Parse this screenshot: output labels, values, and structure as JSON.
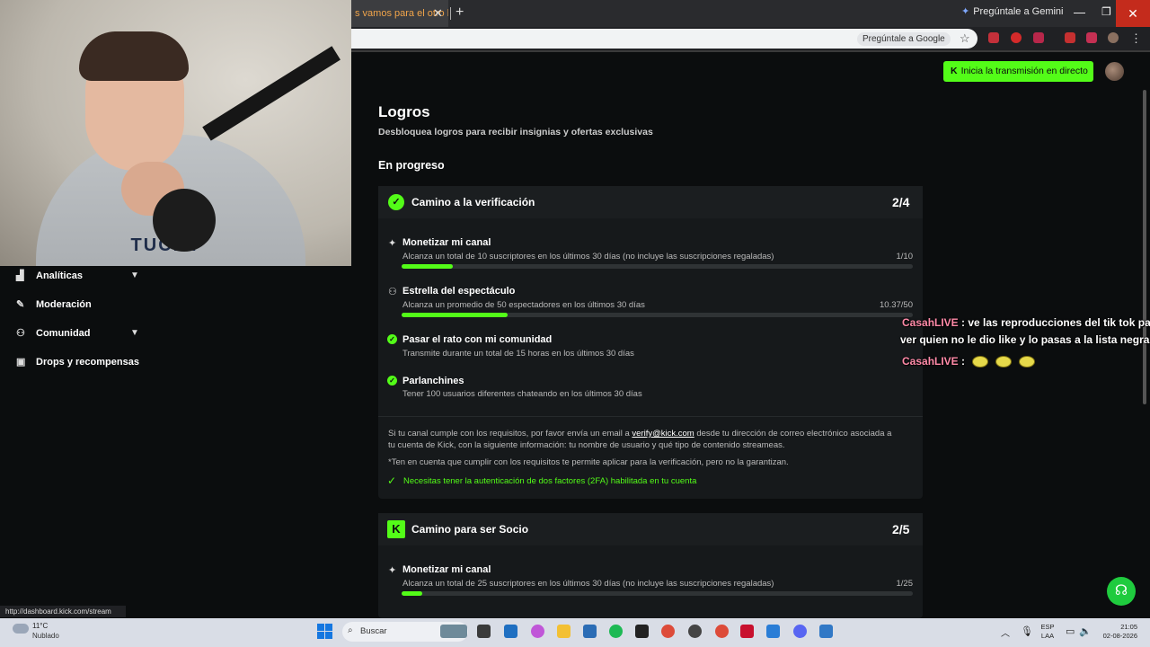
{
  "browser": {
    "tab_title": "s vamos para el otro lad",
    "tab_close": "✕",
    "new_tab": "+",
    "gemini": "Pregúntale a Gemini",
    "ask_google": "Pregúntale a Google",
    "status_url": "http://dashboard.kick.com/stream"
  },
  "header": {
    "stream_button": "Inicia la transmisión en directo"
  },
  "page": {
    "title": "Logros",
    "subtitle": "Desbloquea logros para recibir insignias y ofertas exclusivas",
    "section": "En progreso"
  },
  "card_verification": {
    "title": "Camino a la verificación",
    "count": "2/4",
    "items": [
      {
        "title": "Monetizar mi canal",
        "desc": "Alcanza un total de 10 suscriptores en los últimos 30 días (no incluye las suscripciones regaladas)",
        "progress": "1/10",
        "fill": 0.1
      },
      {
        "title": "Estrella del espectáculo",
        "desc": "Alcanza un promedio de 50 espectadores en los últimos 30 días",
        "progress": "10.37/50",
        "fill": 0.2074
      },
      {
        "title": "Pasar el rato con mi comunidad",
        "desc": "Transmite durante un total de 15 horas en los últimos 30 días"
      },
      {
        "title": "Parlanchines",
        "desc": "Tener 100 usuarios diferentes chateando en los últimos 30 días"
      }
    ],
    "info_prefix": "Si tu canal cumple con los requisitos, por favor envía un email a ",
    "info_email": "verify@kick.com",
    "info_suffix_line1": " desde tu dirección de correo electrónico asociada a",
    "info_line2": "tu cuenta de Kick, con la siguiente información: tu nombre de usuario y qué tipo de contenido streameas.",
    "note": "*Ten en cuenta que cumplir con los requisitos te permite aplicar para la verificación, pero no la garantizan.",
    "twofa": "Necesitas tener la autenticación de dos factores (2FA) habilitada en tu cuenta"
  },
  "card_partner": {
    "title": "Camino para ser Socio",
    "count": "2/5",
    "items": [
      {
        "title": "Monetizar mi canal",
        "desc": "Alcanza un total de 25 suscriptores en los últimos 30 días (no incluye las suscripciones regaladas)",
        "progress": "1/25",
        "fill": 0.04
      }
    ]
  },
  "sidebar": {
    "items": [
      {
        "label": "Analíticas"
      },
      {
        "label": "Moderación"
      },
      {
        "label": "Comunidad"
      },
      {
        "label": "Drops y recompensas"
      }
    ]
  },
  "chat": {
    "user1": "CasahLIVE",
    "msg1_line1": " : ve las reproducciones del tik tok pa",
    "msg1_line2": "ver quien no le dio like y lo pasas a la lista negra",
    "user2": "CasahLIVE",
    "msg2": " :"
  },
  "webcam": {
    "shirt": "TUCKY"
  },
  "taskbar": {
    "temp": "11°C",
    "weather": "Nublado",
    "search": "Buscar",
    "lang1": "ESP",
    "lang2": "LAA",
    "time": "21:05",
    "date": "02-08-2026"
  },
  "colors": {
    "accent": "#53fc18",
    "chat_user": "#ff8aa8"
  }
}
